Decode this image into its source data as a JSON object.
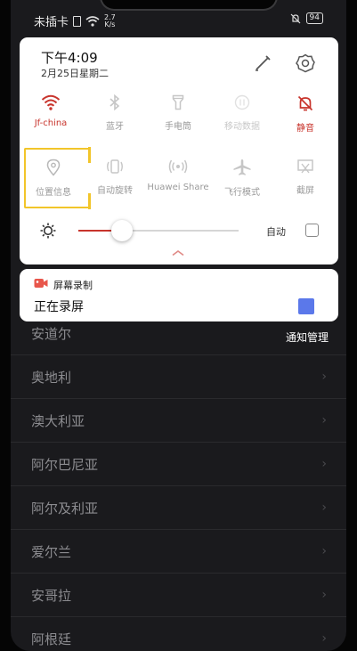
{
  "status": {
    "carrier": "未插卡",
    "speed_value": "2.7",
    "speed_unit": "K/s",
    "battery": "94"
  },
  "panel": {
    "time": "下午4:09",
    "date": "2月25日星期二",
    "tiles": [
      {
        "label": "Jf-china",
        "icon": "wifi-icon",
        "active": true
      },
      {
        "label": "蓝牙",
        "icon": "bluetooth-icon",
        "active": false
      },
      {
        "label": "手电筒",
        "icon": "flashlight-icon",
        "active": false
      },
      {
        "label": "移动数据",
        "icon": "mobile-data-icon",
        "active": false
      },
      {
        "label": "静音",
        "icon": "bell-off-icon",
        "active": true
      },
      {
        "label": "位置信息",
        "icon": "location-icon",
        "active": false
      },
      {
        "label": "自动旋转",
        "icon": "rotate-icon",
        "active": false
      },
      {
        "label": "Huawei Share",
        "icon": "share-icon",
        "active": false
      },
      {
        "label": "飞行模式",
        "icon": "airplane-icon",
        "active": false
      },
      {
        "label": "截屏",
        "icon": "screenshot-icon",
        "active": false
      }
    ],
    "brightness": 0.27,
    "auto_label": "自动"
  },
  "notification": {
    "app": "屏幕录制",
    "text": "正在录屏"
  },
  "notif_manage": "通知管理",
  "list": [
    "安道尔",
    "奥地利",
    "澳大利亚",
    "阿尔巴尼亚",
    "阿尔及利亚",
    "爱尔兰",
    "安哥拉",
    "阿根廷"
  ],
  "colors": {
    "accent_red": "#c8342c",
    "highlight_yellow": "#f2c52a",
    "stop_blue": "#5b78ea"
  }
}
